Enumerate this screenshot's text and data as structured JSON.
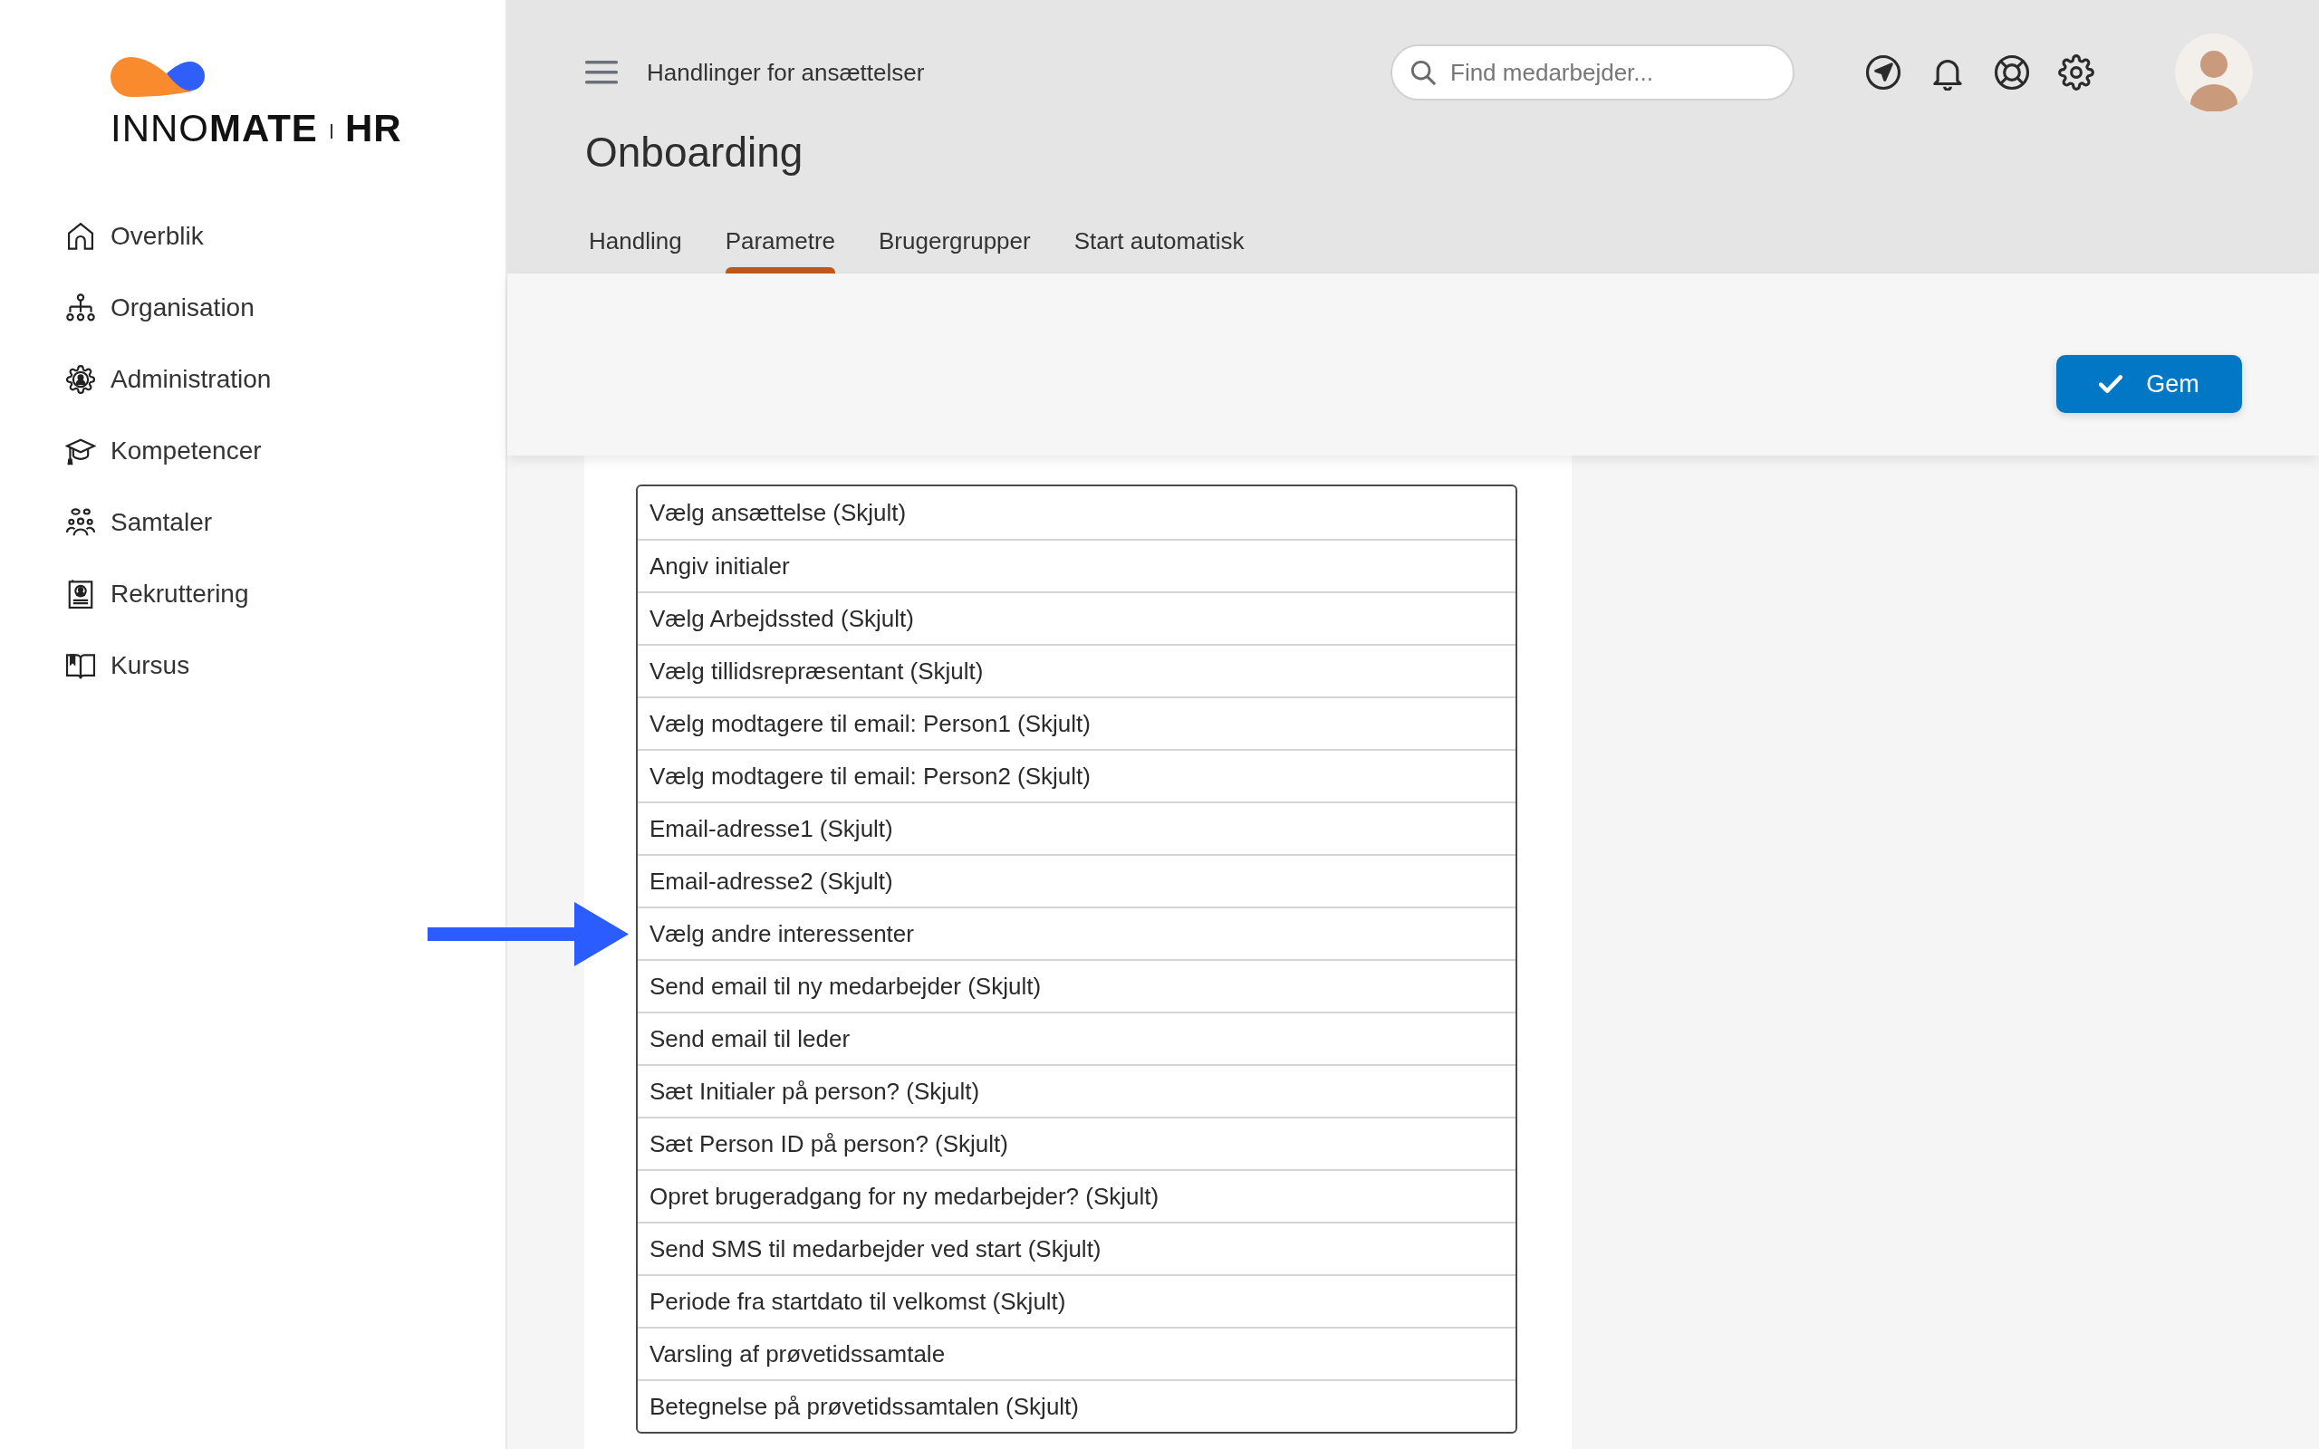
{
  "sidebar": {
    "logo": {
      "wordmark": "INNO**MATE**",
      "suffix": "HR"
    },
    "items": [
      {
        "label": "Overblik",
        "selected": false
      },
      {
        "label": "Organisation",
        "selected": false
      },
      {
        "label": "Administration",
        "selected": false
      },
      {
        "label": "Kompetencer",
        "selected": false
      },
      {
        "label": "Samtaler",
        "selected": false
      },
      {
        "label": "Rekruttering",
        "selected": false
      },
      {
        "label": "Kursus",
        "selected": false
      }
    ]
  },
  "header": {
    "section_title": "Handlinger for ansættelser",
    "title": "Onboarding",
    "search": {
      "placeholder": "Find medarbejder..."
    },
    "tabs": [
      {
        "label": "Handling",
        "selected": false
      },
      {
        "label": "Parametre",
        "selected": true
      },
      {
        "label": "Brugergrupper",
        "selected": false
      },
      {
        "label": "Start automatisk",
        "selected": false
      }
    ]
  },
  "toolbar": {
    "save_button": "Gem"
  },
  "parameters": {
    "rows": [
      {
        "label": "Vælg ansættelse (Skjult)",
        "highlighted": false
      },
      {
        "label": "Angiv initialer",
        "highlighted": false
      },
      {
        "label": "Vælg Arbejdssted (Skjult)",
        "highlighted": false
      },
      {
        "label": "Vælg tillidsrepræsentant (Skjult)",
        "highlighted": false
      },
      {
        "label": "Vælg modtagere til email: Person1 (Skjult)",
        "highlighted": false
      },
      {
        "label": "Vælg modtagere til email: Person2 (Skjult)",
        "highlighted": false
      },
      {
        "label": "Email-adresse1 (Skjult)",
        "highlighted": false
      },
      {
        "label": "Email-adresse2 (Skjult)",
        "highlighted": false
      },
      {
        "label": "Vælg andre interessenter",
        "highlighted": true
      },
      {
        "label": "Send email til ny medarbejder (Skjult)",
        "highlighted": false
      },
      {
        "label": "Send email til leder",
        "highlighted": false
      },
      {
        "label": "Sæt Initialer på person? (Skjult)",
        "highlighted": false
      },
      {
        "label": "Sæt Person ID på person? (Skjult)",
        "highlighted": false
      },
      {
        "label": "Opret brugeradgang for ny medarbejder? (Skjult)",
        "highlighted": false
      },
      {
        "label": "Send SMS til medarbejder ved start (Skjult)",
        "highlighted": false
      },
      {
        "label": "Periode fra startdato til velkomst (Skjult)",
        "highlighted": false
      },
      {
        "label": "Varsling af prøvetidssamtale",
        "highlighted": false
      },
      {
        "label": "Betegnelse på prøvetidssamtalen (Skjult)",
        "highlighted": false
      }
    ]
  }
}
